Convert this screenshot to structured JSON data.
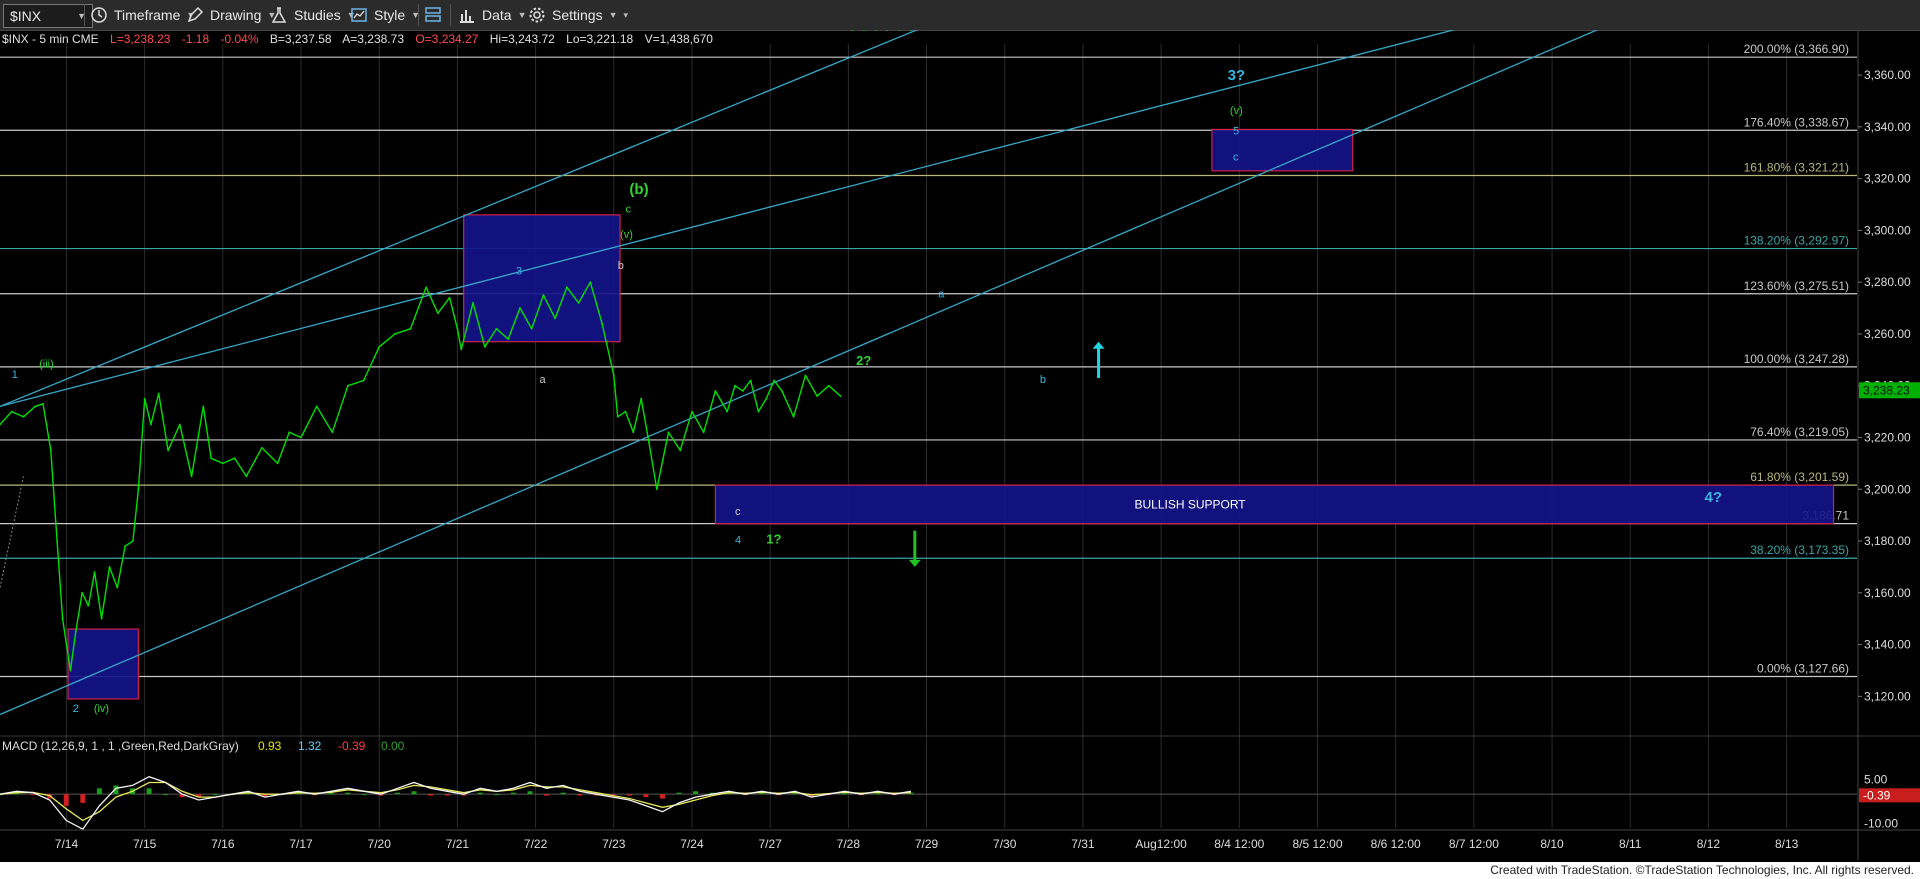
{
  "toolbar": {
    "symbol": "$INX",
    "items": [
      {
        "label": "Timeframe",
        "icon": "clock-icon"
      },
      {
        "label": "Drawing",
        "icon": "pencil-icon"
      },
      {
        "label": "Studies",
        "icon": "flask-icon"
      },
      {
        "label": "Style",
        "icon": "chart-style-icon"
      },
      {
        "label": "",
        "icon": "layout-icon"
      },
      {
        "label": "Data",
        "icon": "data-bars-icon"
      },
      {
        "label": "Settings",
        "icon": "gear-icon"
      }
    ]
  },
  "info_bar": {
    "symbol": "$INX - 5 min  CME",
    "last": "L=3,238.23",
    "change": "-1.18",
    "pct": "-0.04%",
    "bid": "B=3,237.58",
    "ask": "A=3,238.73",
    "open": "O=3,234.27",
    "high": "Hi=3,243.72",
    "low": "Lo=3,221.18",
    "volume": "V=1,438,670"
  },
  "colors": {
    "background": "#000000",
    "price": "#00e000",
    "trendline": "#35a9c9",
    "fib_line": "#c8c8c8",
    "box_fill": "#14148a",
    "box_border": "#d0204a",
    "wave_green": "#2fd42f",
    "wave_blue": "#38b6e0",
    "last_price_bg": "#00b000"
  },
  "chart_data": {
    "type": "line",
    "title": "$INX - 5 min",
    "x_ticks": [
      "7/14",
      "7/15",
      "7/16",
      "7/17",
      "7/20",
      "7/21",
      "7/22",
      "7/23",
      "7/24",
      "7/27",
      "7/28",
      "7/29",
      "7/30",
      "7/31",
      "Aug12:00",
      "8/4 12:00",
      "8/5 12:00",
      "8/6 12:00",
      "8/7 12:00",
      "8/10",
      "8/11",
      "8/12",
      "8/13"
    ],
    "y_ticks": [
      3120,
      3140,
      3160,
      3180,
      3200,
      3220,
      3240,
      3260,
      3280,
      3300,
      3320,
      3340,
      3360
    ],
    "y_tick_labels": [
      "3,120.00",
      "3,140.00",
      "3,160.00",
      "3,180.00",
      "3,200.00",
      "3,220.00",
      "3,240.00",
      "3,260.00",
      "3,280.00",
      "3,300.00",
      "3,320.00",
      "3,340.00",
      "3,360.00"
    ],
    "ylim": [
      3107,
      3372
    ],
    "x_range": [
      -0.85,
      22.9
    ],
    "last_price": {
      "value": 3238.23,
      "label": "3,238.23"
    },
    "price_series": {
      "name": "$INX",
      "x": [
        -0.85,
        -0.7,
        -0.55,
        -0.4,
        -0.3,
        -0.2,
        -0.12,
        -0.05,
        0.0,
        0.05,
        0.12,
        0.2,
        0.28,
        0.36,
        0.45,
        0.55,
        0.65,
        0.75,
        0.85,
        0.92,
        1.0,
        1.08,
        1.18,
        1.3,
        1.45,
        1.6,
        1.75,
        1.85,
        2.0,
        2.15,
        2.3,
        2.5,
        2.7,
        2.85,
        3.0,
        3.2,
        3.4,
        3.6,
        3.8,
        4.0,
        4.2,
        4.4,
        4.6,
        4.75,
        4.9,
        5.0,
        5.05,
        5.2,
        5.35,
        5.5,
        5.65,
        5.8,
        5.95,
        6.1,
        6.25,
        6.4,
        6.55,
        6.7,
        6.85,
        7.0,
        7.05,
        7.15,
        7.25,
        7.35,
        7.45,
        7.55,
        7.7,
        7.85,
        8.0,
        8.15,
        8.3,
        8.45,
        8.55,
        8.65,
        8.75,
        8.85,
        8.95,
        9.05,
        9.15,
        9.3,
        9.45,
        9.6,
        9.75,
        9.9,
        10.05,
        10.2,
        10.35,
        10.5,
        10.65,
        10.8
      ],
      "y": [
        3225,
        3230,
        3228,
        3232,
        3233,
        3215,
        3180,
        3150,
        3140,
        3130,
        3145,
        3160,
        3155,
        3168,
        3150,
        3170,
        3162,
        3178,
        3180,
        3200,
        3235,
        3225,
        3237,
        3215,
        3225,
        3205,
        3232,
        3212,
        3210,
        3212,
        3205,
        3216,
        3210,
        3222,
        3220,
        3232,
        3222,
        3240,
        3242,
        3255,
        3260,
        3262,
        3278,
        3268,
        3274,
        3262,
        3254,
        3272,
        3255,
        3262,
        3258,
        3270,
        3262,
        3275,
        3266,
        3278,
        3272,
        3280,
        3264,
        3244,
        3228,
        3230,
        3222,
        3235,
        3218,
        3200,
        3222,
        3215,
        3230,
        3222,
        3238,
        3230,
        3240,
        3238,
        3242,
        3230,
        3235,
        3242,
        3238,
        3228,
        3244,
        3236,
        3240,
        3236
      ],
      "color": "#00e000"
    },
    "fib_levels": [
      {
        "label": "200.00% (3,366.90)",
        "value": 3366.9,
        "color": "#c8c8c8"
      },
      {
        "label": "176.40% (3,338.67)",
        "value": 3338.67,
        "color": "#c8c8c8"
      },
      {
        "label": "161.80% (3,321.21)",
        "value": 3321.21,
        "color": "#b8b87a"
      },
      {
        "label": "138.20% (3,292.97)",
        "value": 3292.97,
        "color": "#3aa6a6"
      },
      {
        "label": "123.60% (3,275.51)",
        "value": 3275.51,
        "color": "#c8c8c8"
      },
      {
        "label": "100.00% (3,247.28)",
        "value": 3247.28,
        "color": "#c8c8c8"
      },
      {
        "label": "76.40% (3,219.05)",
        "value": 3219.05,
        "color": "#c8c8c8"
      },
      {
        "label": "61.80% (3,201.59)",
        "value": 3201.59,
        "color": "#b8b87a"
      },
      {
        "label": "3,186.71",
        "value": 3186.71,
        "color": "#c8c8c8"
      },
      {
        "label": "38.20% (3,173.35)",
        "value": 3173.35,
        "color": "#3aa6a6"
      },
      {
        "label": "0.00% (3,127.66)",
        "value": 3127.66,
        "color": "#c8c8c8"
      }
    ],
    "trendlines": [
      {
        "x1": -0.85,
        "y1": 3232,
        "x2": 12.05,
        "y2": 3392
      },
      {
        "x1": -0.85,
        "y1": 3232,
        "x2": 19.6,
        "y2": 3392
      },
      {
        "x1": -0.85,
        "y1": 3113,
        "x2": 20.7,
        "y2": 3392
      }
    ],
    "boxes": [
      {
        "x1": 0.02,
        "x2": 0.92,
        "y1": 3119,
        "y2": 3146,
        "label": ""
      },
      {
        "x1": 5.08,
        "x2": 7.08,
        "y1": 3257,
        "y2": 3306,
        "label": ""
      },
      {
        "x1": 14.65,
        "x2": 16.45,
        "y1": 3323,
        "y2": 3339,
        "label": ""
      },
      {
        "x1": 8.3,
        "x2": 22.6,
        "y1": 3186.71,
        "y2": 3201.59,
        "label": "BULLISH SUPPORT"
      }
    ],
    "annotations": [
      {
        "text": "1",
        "x": -0.7,
        "y": 3243,
        "color": "#38b6e0",
        "size": 11
      },
      {
        "text": "(iii)",
        "x": -0.35,
        "y": 3247,
        "color": "#2fd42f",
        "size": 11
      },
      {
        "text": "2",
        "x": 0.08,
        "y": 3114,
        "color": "#38b6e0",
        "size": 11
      },
      {
        "text": "(iv)",
        "x": 0.35,
        "y": 3114,
        "color": "#2fd42f",
        "size": 11
      },
      {
        "text": "3",
        "x": 5.75,
        "y": 3283,
        "color": "#38b6e0",
        "size": 11
      },
      {
        "text": "a",
        "x": 6.05,
        "y": 3241,
        "color": "#c8c8c8",
        "size": 11
      },
      {
        "text": "b",
        "x": 7.05,
        "y": 3285,
        "color": "#c8c8c8",
        "size": 11
      },
      {
        "text": "(v)",
        "x": 7.08,
        "y": 3297,
        "color": "#2fd42f",
        "size": 11
      },
      {
        "text": "c",
        "x": 7.15,
        "y": 3307,
        "color": "#2fd42f",
        "size": 11
      },
      {
        "text": "(b)",
        "x": 7.2,
        "y": 3314,
        "color": "#2fd42f",
        "size": 15
      },
      {
        "text": "c",
        "x": 8.55,
        "y": 3190,
        "color": "#c8c8c8",
        "size": 11
      },
      {
        "text": "4",
        "x": 8.55,
        "y": 3179,
        "color": "#38b6e0",
        "size": 11
      },
      {
        "text": "1?",
        "x": 8.95,
        "y": 3179,
        "color": "#2fd42f",
        "size": 13
      },
      {
        "text": "2?",
        "x": 10.1,
        "y": 3248,
        "color": "#2fd42f",
        "size": 13
      },
      {
        "text": "a",
        "x": 11.15,
        "y": 3274,
        "color": "#38b6e0",
        "size": 11
      },
      {
        "text": "b",
        "x": 12.45,
        "y": 3241,
        "color": "#38b6e0",
        "size": 11
      },
      {
        "text": "3?",
        "x": 14.85,
        "y": 3358,
        "color": "#38b6e0",
        "size": 15
      },
      {
        "text": "(v)",
        "x": 14.88,
        "y": 3345,
        "color": "#2fd42f",
        "size": 11
      },
      {
        "text": "5",
        "x": 14.92,
        "y": 3337,
        "color": "#38b6e0",
        "size": 11
      },
      {
        "text": "c",
        "x": 14.92,
        "y": 3327,
        "color": "#38b6e0",
        "size": 11
      },
      {
        "text": "4?",
        "x": 20.95,
        "y": 3195,
        "color": "#38b6e0",
        "size": 15
      }
    ],
    "arrows": [
      {
        "direction": "up",
        "x": 13.2,
        "y_from": 3243,
        "y_to": 3257,
        "color": "#22d4e0"
      },
      {
        "direction": "down",
        "x": 10.85,
        "y_from": 3184,
        "y_to": 3170,
        "color": "#22c022"
      }
    ],
    "macd": {
      "legend": "MACD (12,26,9, 1 , 1 ,Green,Red,DarkGray)",
      "values": [
        "0.93",
        "1.32",
        "-0.39",
        "0.00"
      ],
      "value_colors": [
        "#e6e600",
        "#5fd0ff",
        "#ff4040",
        "#2fa02f"
      ],
      "y_ticks": [
        "5.00",
        "-10.00"
      ],
      "last_label": "-0.39",
      "ylim": [
        -14,
        10
      ],
      "macd_line": [
        0,
        1,
        0.5,
        -2,
        -9,
        -12,
        -4,
        2,
        3,
        6,
        4,
        0,
        -2,
        -1,
        0,
        1,
        -1,
        0,
        1,
        0,
        1,
        2,
        1,
        0,
        2,
        4,
        2,
        1,
        0,
        2,
        1,
        2,
        4,
        2,
        3,
        1,
        0,
        -1,
        -2,
        -4,
        -6,
        -3,
        -1,
        0,
        1,
        0,
        1,
        0,
        1,
        -1,
        0,
        1,
        0,
        1,
        0,
        1
      ],
      "signal_line": [
        0,
        0.5,
        0.6,
        -0.5,
        -5,
        -9,
        -6,
        -1,
        1,
        4,
        4,
        1,
        -1,
        -1,
        0,
        0.5,
        0,
        0,
        0.5,
        0.3,
        0.6,
        1.5,
        1,
        0.5,
        1.5,
        3,
        2.5,
        1.5,
        0.5,
        1.5,
        1,
        1.5,
        3,
        2.5,
        2.5,
        1.5,
        0.5,
        -0.5,
        -1.5,
        -3,
        -4.5,
        -3.5,
        -2,
        -0.5,
        0.5,
        0.3,
        0.6,
        0.3,
        0.6,
        -0.2,
        0.2,
        0.6,
        0.3,
        0.6,
        0.3,
        0.5
      ]
    }
  },
  "footer": {
    "text": "Created with TradeStation. ©TradeStation Technologies, Inc. All rights reserved."
  }
}
